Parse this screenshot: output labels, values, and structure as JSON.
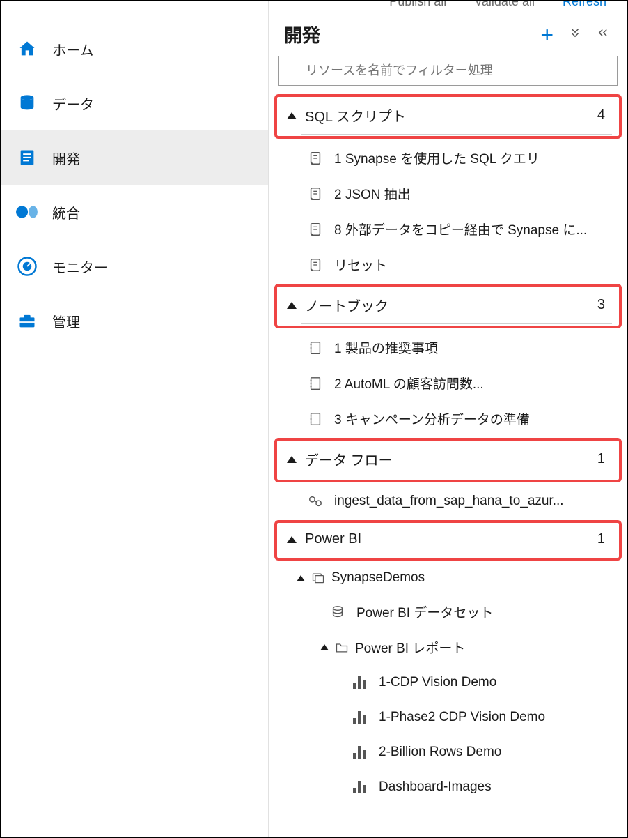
{
  "sidebar": {
    "items": [
      {
        "key": "home",
        "label": "ホーム"
      },
      {
        "key": "data",
        "label": "データ"
      },
      {
        "key": "develop",
        "label": "開発"
      },
      {
        "key": "integrate",
        "label": "統合"
      },
      {
        "key": "monitor",
        "label": "モニター"
      },
      {
        "key": "manage",
        "label": "管理"
      }
    ],
    "active_key": "develop"
  },
  "toolbar_partial": {
    "publish": "Publish all",
    "validate": "Validate all",
    "refresh": "Refresh"
  },
  "header": {
    "title": "開発"
  },
  "filter": {
    "placeholder": "リソースを名前でフィルター処理"
  },
  "sections": [
    {
      "key": "sql-scripts",
      "label": "SQL スクリプト",
      "count": 4,
      "highlighted": true,
      "icon": "script",
      "items": [
        {
          "label": "1 Synapse を使用した SQL クエリ"
        },
        {
          "label": "2 JSON 抽出"
        },
        {
          "label": "8 外部データをコピー経由で Synapse に..."
        },
        {
          "label": "リセット"
        }
      ]
    },
    {
      "key": "notebooks",
      "label": "ノートブック",
      "count": 3,
      "highlighted": true,
      "icon": "notebook",
      "items": [
        {
          "label": "1 製品の推奨事項"
        },
        {
          "label": "2 AutoML の顧客訪問数..."
        },
        {
          "label": "3 キャンペーン分析データの準備"
        }
      ]
    },
    {
      "key": "data-flows",
      "label": "データ フロー",
      "count": 1,
      "highlighted": true,
      "icon": "dataflow",
      "items": [
        {
          "label": "ingest_data_from_sap_hana_to_azur..."
        }
      ]
    },
    {
      "key": "power-bi",
      "label": "Power BI",
      "count": 1,
      "highlighted": true,
      "icon": "powerbi",
      "children": {
        "workspace": {
          "label": "SynapseDemos",
          "datasets_label": "Power BI データセット",
          "reports_label": "Power BI レポート",
          "reports": [
            {
              "label": "1-CDP Vision Demo"
            },
            {
              "label": "1-Phase2 CDP Vision Demo"
            },
            {
              "label": "2-Billion Rows Demo"
            },
            {
              "label": "Dashboard-Images"
            }
          ]
        }
      }
    }
  ]
}
